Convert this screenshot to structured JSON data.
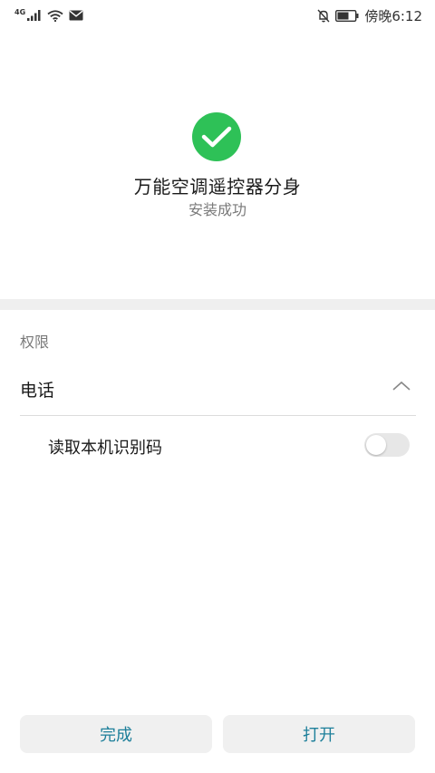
{
  "status_bar": {
    "network_type": "4G",
    "time": "傍晚6:12"
  },
  "hero": {
    "app_name": "万能空调遥控器分身",
    "install_status": "安装成功",
    "check_color": "#2ec157"
  },
  "permissions": {
    "section_title": "权限",
    "groups": [
      {
        "label": "电话",
        "expanded": true,
        "items": [
          {
            "label": "读取本机识别码",
            "enabled": false
          }
        ]
      }
    ]
  },
  "actions": {
    "done_label": "完成",
    "open_label": "打开",
    "accent_color": "#1d7f9a"
  }
}
